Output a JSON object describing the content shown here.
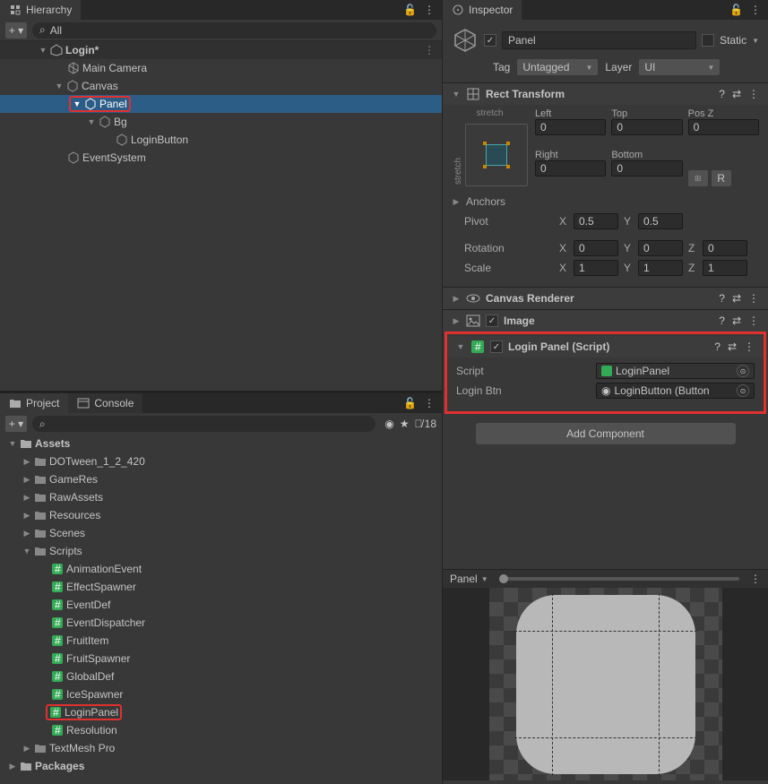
{
  "hierarchy": {
    "tab": "Hierarchy",
    "search_placeholder": "All",
    "scene": "Login*",
    "items": {
      "main_camera": "Main Camera",
      "canvas": "Canvas",
      "panel": "Panel",
      "bg": "Bg",
      "login_button": "LoginButton",
      "event_system": "EventSystem"
    }
  },
  "project": {
    "tab_project": "Project",
    "tab_console": "Console",
    "hidden_count": "18",
    "root": "Assets",
    "folders": {
      "dotween": "DOTween_1_2_420",
      "gameres": "GameRes",
      "rawassets": "RawAssets",
      "resources": "Resources",
      "scenes": "Scenes",
      "scripts": "Scripts",
      "textmesh": "TextMesh Pro"
    },
    "scripts": {
      "animation_event": "AnimationEvent",
      "effect_spawner": "EffectSpawner",
      "event_def": "EventDef",
      "event_dispatcher": "EventDispatcher",
      "fruit_item": "FruitItem",
      "fruit_spawner": "FruitSpawner",
      "global_def": "GlobalDef",
      "ice_spawner": "IceSpawner",
      "login_panel": "LoginPanel",
      "resolution": "Resolution"
    },
    "packages": "Packages"
  },
  "inspector": {
    "tab": "Inspector",
    "name": "Panel",
    "static_label": "Static",
    "tag_label": "Tag",
    "tag_value": "Untagged",
    "layer_label": "Layer",
    "layer_value": "UI",
    "rect_transform": {
      "title": "Rect Transform",
      "stretch": "stretch",
      "left_label": "Left",
      "left": "0",
      "top_label": "Top",
      "top": "0",
      "posz_label": "Pos Z",
      "posz": "0",
      "right_label": "Right",
      "right": "0",
      "bottom_label": "Bottom",
      "bottom": "0",
      "anchors": "Anchors",
      "pivot": "Pivot",
      "pivot_x": "0.5",
      "pivot_y": "0.5",
      "rotation": "Rotation",
      "rot_x": "0",
      "rot_y": "0",
      "rot_z": "0",
      "scale": "Scale",
      "scale_x": "1",
      "scale_y": "1",
      "scale_z": "1",
      "x": "X",
      "y": "Y",
      "z": "Z"
    },
    "canvas_renderer": "Canvas Renderer",
    "image": "Image",
    "login_panel": {
      "title": "Login Panel (Script)",
      "script_label": "Script",
      "script_value": "LoginPanel",
      "login_btn_label": "Login Btn",
      "login_btn_value": "LoginButton (Button"
    },
    "add_component": "Add Component",
    "preview_label": "Panel",
    "blueprint": "R"
  }
}
